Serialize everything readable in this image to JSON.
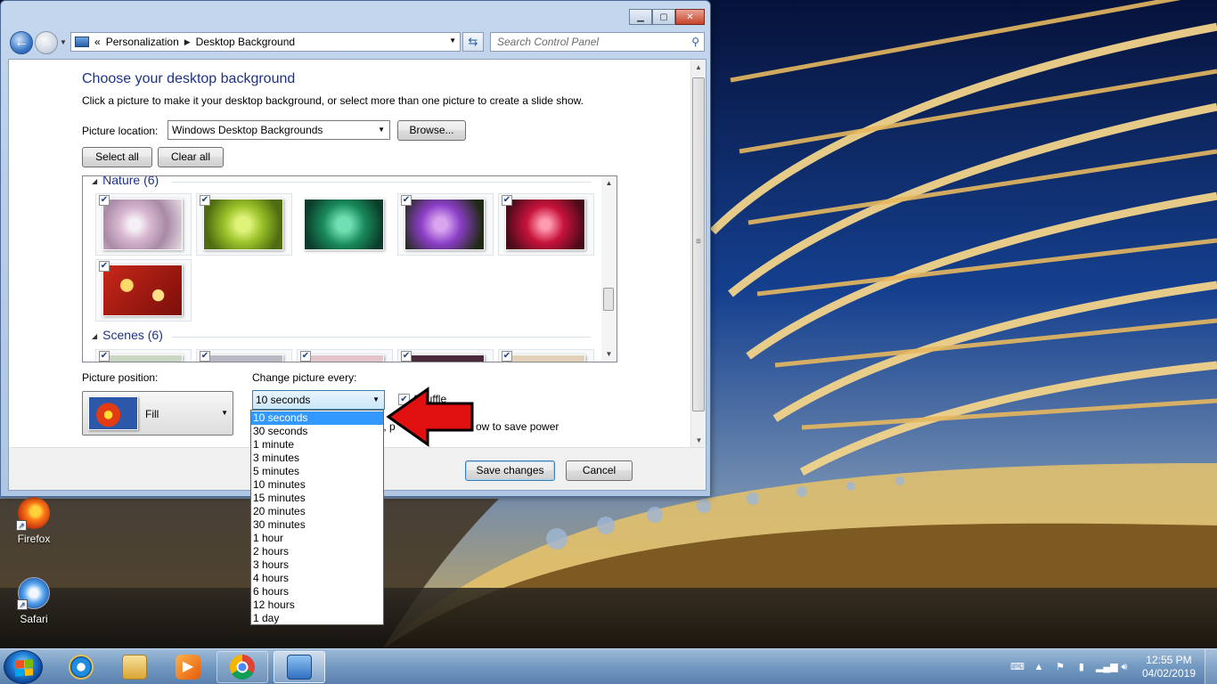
{
  "window": {
    "controls": {
      "minimize": "▁",
      "maximize": "▢",
      "close": "✕"
    },
    "address": {
      "overflow": "«",
      "crumb1": "Personalization",
      "crumb2": "Desktop Background"
    },
    "search_placeholder": "Search Control Panel",
    "title": "Choose your desktop background",
    "subtitle": "Click a picture to make it your desktop background, or select more than one picture to create a slide show.",
    "picture_location_label": "Picture location:",
    "picture_location_value": "Windows Desktop Backgrounds",
    "browse_label": "Browse...",
    "select_all_label": "Select all",
    "clear_all_label": "Clear all",
    "groups": [
      {
        "name": "Nature (6)",
        "checked": true
      },
      {
        "name": "Scenes (6)",
        "checked": true
      }
    ],
    "picture_position_label": "Picture position:",
    "picture_position_value": "Fill",
    "change_picture_label": "Change picture every:",
    "change_picture_value": "10 seconds",
    "shuffle_label": "Shuffle",
    "power_text_fragment_1": "r, p",
    "power_text_fragment_2": "ow to save power",
    "save_label": "Save changes",
    "cancel_label": "Cancel"
  },
  "dropdown": {
    "options": [
      "10 seconds",
      "30 seconds",
      "1 minute",
      "3 minutes",
      "5 minutes",
      "10 minutes",
      "15 minutes",
      "20 minutes",
      "30 minutes",
      "1 hour",
      "2 hours",
      "3 hours",
      "4 hours",
      "6 hours",
      "12 hours",
      "1 day"
    ],
    "selected_index": 0
  },
  "desktop_icons": [
    {
      "label": "Firefox",
      "icon": "firefox-icon"
    },
    {
      "label": "Safari",
      "icon": "safari-icon"
    }
  ],
  "taskbar": {
    "apps": [
      "internet-explorer-icon",
      "windows-explorer-icon",
      "media-player-icon",
      "chrome-icon",
      "control-panel-icon"
    ],
    "clock_time": "12:55 PM",
    "clock_date": "04/02/2019"
  },
  "colors": {
    "accent": "#1e3287",
    "selection": "#3399ff",
    "arrow": "#e01010"
  }
}
